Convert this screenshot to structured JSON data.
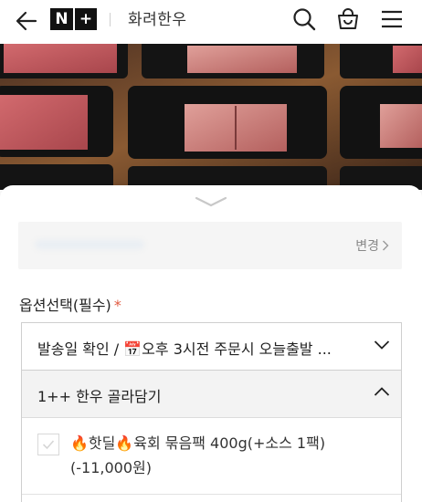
{
  "header": {
    "logo_n": "N",
    "logo_plus": "+",
    "brand": "화려한우"
  },
  "address": {
    "change_label": "변경"
  },
  "options": {
    "title": "옵션선택(필수)",
    "required_mark": "*",
    "shipping_select": "발송일 확인 / 📅오후 3시전 주문시 오늘출발 ...",
    "group_label": "1++ 한우 골라담기",
    "item_label": "🔥핫딜🔥육회 묶음팩 400g(+소스 1팩)(-11,000원)"
  },
  "colors": {
    "required": "#e05a40",
    "brand_box": "#111111"
  },
  "icons": [
    "arrow-left-icon",
    "search-icon",
    "shopping-bag-icon",
    "hamburger-menu-icon",
    "chevron-down-icon",
    "chevron-up-icon",
    "chevron-right-icon",
    "checkmark-icon"
  ]
}
